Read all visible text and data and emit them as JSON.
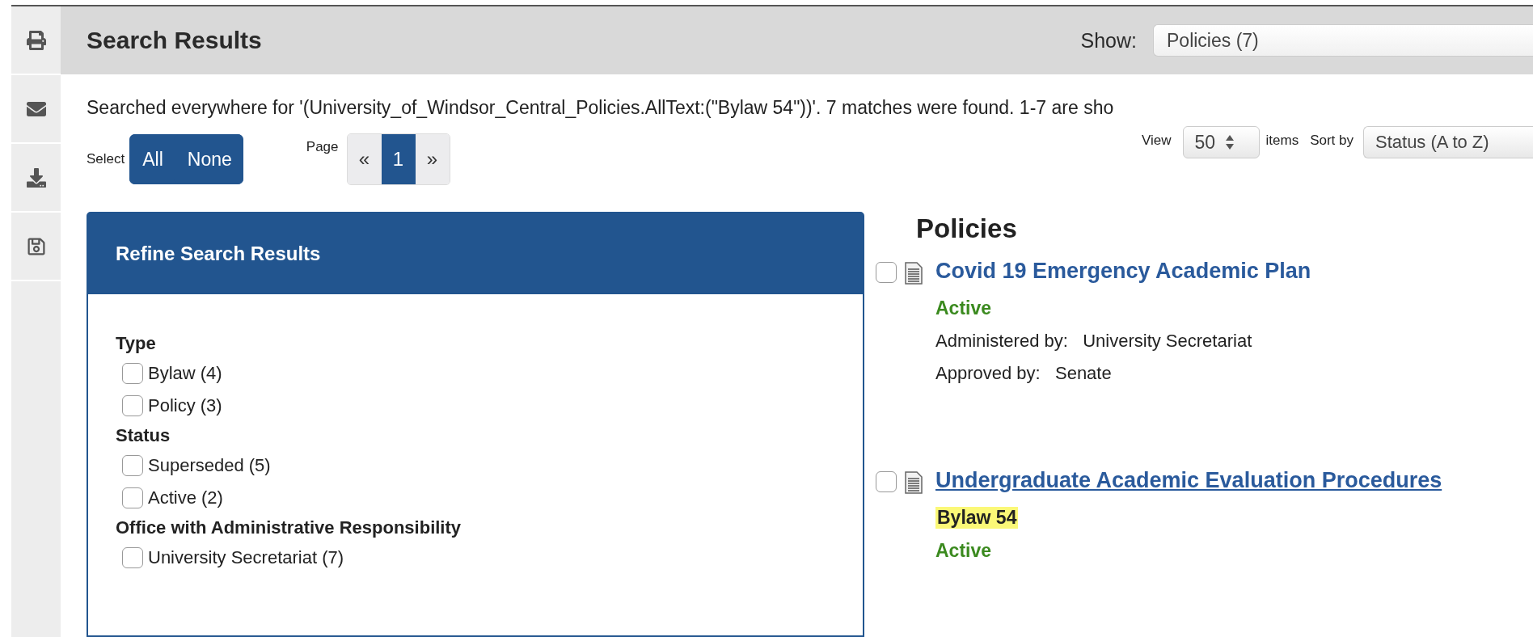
{
  "header": {
    "title": "Search Results",
    "show_label": "Show:",
    "show_value": "Policies (7)"
  },
  "summary": "Searched everywhere for '(University_of_Windsor_Central_Policies.AllText:(\"Bylaw 54\"))'. 7 matches were found. 1-7 are sho",
  "select": {
    "label": "Select",
    "buttons": [
      "All",
      "None"
    ]
  },
  "pager": {
    "label": "Page",
    "items": [
      {
        "label": "«",
        "selected": false
      },
      {
        "label": "1",
        "selected": true
      },
      {
        "label": "»",
        "selected": false
      }
    ]
  },
  "view": {
    "label": "View",
    "value": "50",
    "suffix": "items"
  },
  "sort": {
    "label": "Sort by",
    "value": "Status (A to Z)"
  },
  "refine": {
    "title": "Refine Search Results",
    "groups": [
      {
        "heading": "Type",
        "options": [
          {
            "label": "Bylaw (4)",
            "checked": false
          },
          {
            "label": "Policy (3)",
            "checked": false
          }
        ]
      },
      {
        "heading": "Status",
        "options": [
          {
            "label": "Superseded (5)",
            "checked": false
          },
          {
            "label": "Active (2)",
            "checked": false
          }
        ]
      },
      {
        "heading": "Office with Administrative Responsibility",
        "options": [
          {
            "label": "University Secretariat (7)",
            "checked": false
          }
        ]
      }
    ]
  },
  "results": {
    "heading": "Policies",
    "items": [
      {
        "title": "Covid 19 Emergency Academic Plan",
        "underlined": false,
        "checked": false,
        "status": "Active",
        "fields": [
          {
            "label": "Administered by:",
            "value": "University Secretariat"
          },
          {
            "label": "Approved by:",
            "value": "Senate"
          }
        ]
      },
      {
        "title": "Undergraduate Academic Evaluation Procedures",
        "underlined": true,
        "checked": false,
        "highlight": "Bylaw 54",
        "status": "Active"
      }
    ]
  }
}
